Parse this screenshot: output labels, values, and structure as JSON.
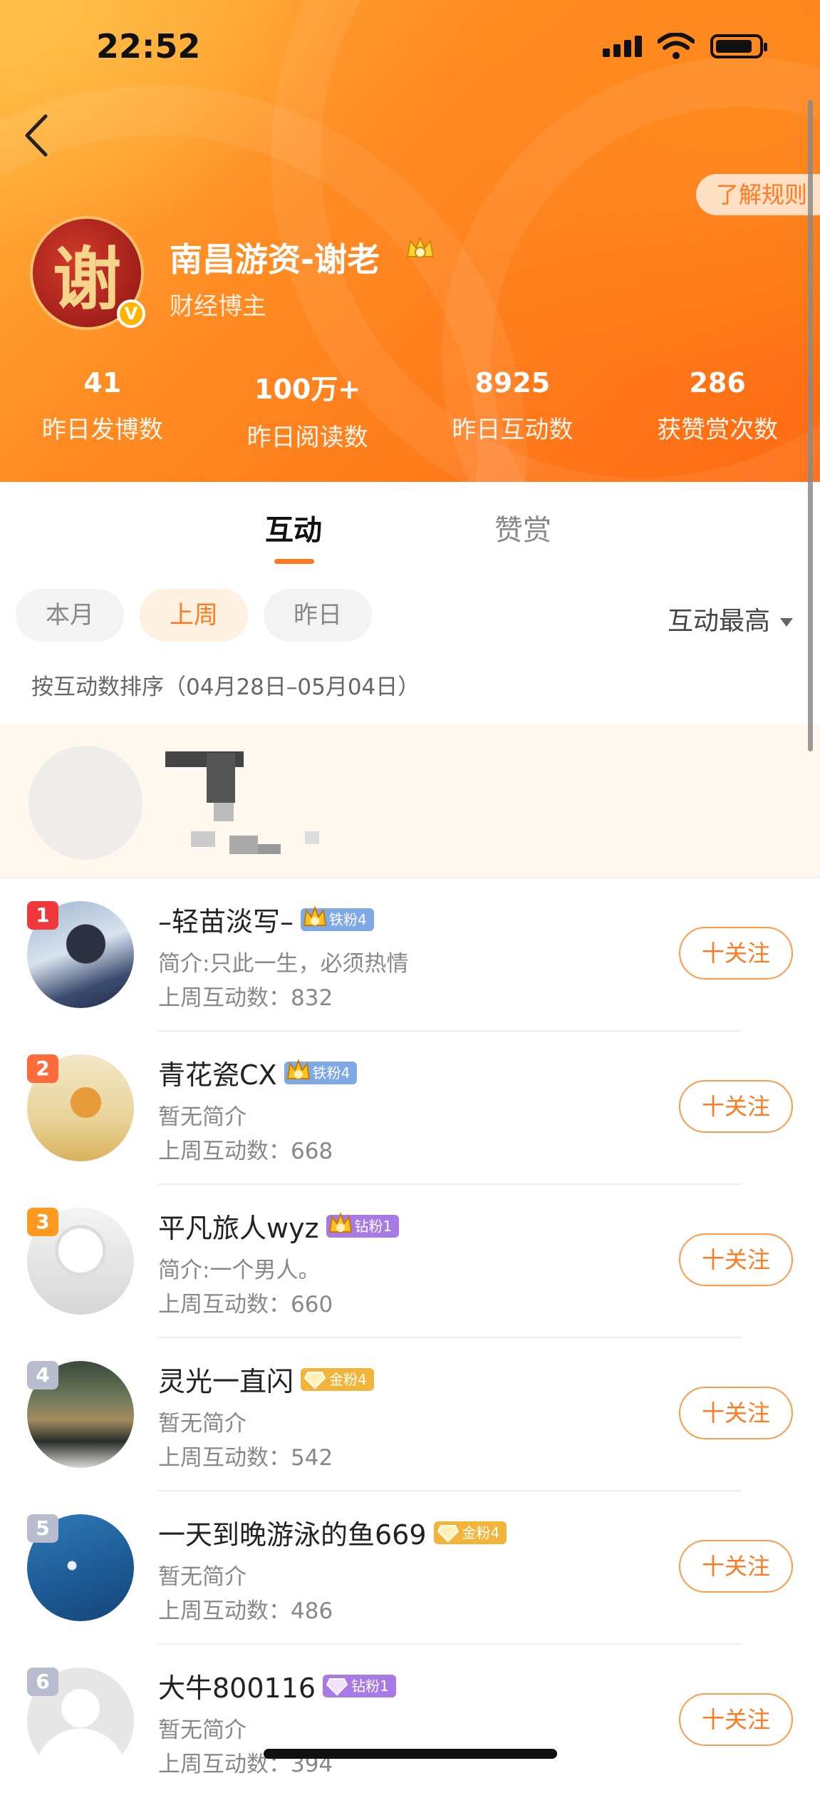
{
  "status_bar": {
    "time": "22:52"
  },
  "header": {
    "rules_button": "了解规则",
    "user": {
      "name": "南昌游资-谢老",
      "avatar_char": "谢",
      "subtitle": "财经博主"
    },
    "stats": [
      {
        "value": "41",
        "label": "昨日发博数"
      },
      {
        "value": "100万+",
        "label": "昨日阅读数"
      },
      {
        "value": "8925",
        "label": "昨日互动数"
      },
      {
        "value": "286",
        "label": "获赞赏次数"
      }
    ]
  },
  "tabs": [
    {
      "label": "互动",
      "active": true
    },
    {
      "label": "赞赏",
      "active": false
    }
  ],
  "filters": {
    "chips": [
      {
        "label": "本月",
        "active": false
      },
      {
        "label": "上周",
        "active": true
      },
      {
        "label": "昨日",
        "active": false
      }
    ],
    "sort": "互动最高",
    "range_note": "按互动数排序（04月28日–05月04日）"
  },
  "list": [
    {
      "rank": "1",
      "name": "–轻苗淡写–",
      "badge": "铁粉4",
      "badge_type": "iron",
      "intro": "简介:只此一生，必须热情",
      "count": "上周互动数：832",
      "follow": "十关注"
    },
    {
      "rank": "2",
      "name": "青花瓷CX",
      "badge": "铁粉4",
      "badge_type": "iron",
      "intro": "暂无简介",
      "count": "上周互动数：668",
      "follow": "十关注"
    },
    {
      "rank": "3",
      "name": "平凡旅人wyz",
      "badge": "钻粉1",
      "badge_type": "diamond",
      "intro": "简介:一个男人。",
      "count": "上周互动数：660",
      "follow": "十关注"
    },
    {
      "rank": "4",
      "name": "灵光一直闪",
      "badge": "金粉4",
      "badge_type": "gold",
      "intro": "暂无简介",
      "count": "上周互动数：542",
      "follow": "十关注"
    },
    {
      "rank": "5",
      "name": "一天到晚游泳的鱼669",
      "badge": "金粉4",
      "badge_type": "gold",
      "intro": "暂无简介",
      "count": "上周互动数：486",
      "follow": "十关注"
    },
    {
      "rank": "6",
      "name": "大牛800116",
      "badge": "钻粉1",
      "badge_type": "diamond",
      "intro": "暂无简介",
      "count": "上周互动数：394",
      "follow": "十关注"
    }
  ]
}
